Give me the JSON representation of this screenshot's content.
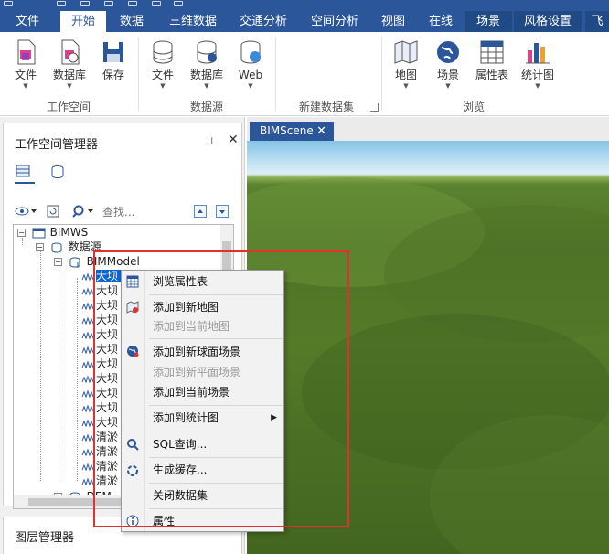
{
  "menu_tabs": [
    {
      "label": "文件"
    },
    {
      "label": "开始"
    },
    {
      "label": "数据"
    },
    {
      "label": "三维数据"
    },
    {
      "label": "交通分析"
    },
    {
      "label": "空间分析"
    },
    {
      "label": "视图"
    },
    {
      "label": "在线"
    },
    {
      "label": "场景"
    },
    {
      "label": "风格设置"
    },
    {
      "label": "飞"
    }
  ],
  "ribbon": {
    "workspace_group": {
      "label": "工作空间",
      "buttons": [
        "文件",
        "数据库",
        "保存"
      ]
    },
    "datasource_group": {
      "label": "数据源",
      "buttons": [
        "文件",
        "数据库",
        "Web"
      ]
    },
    "new_dataset_group": {
      "label": "新建数据集"
    },
    "browse_group": {
      "label": "浏览",
      "buttons": [
        "地图",
        "场景",
        "属性表",
        "统计图"
      ]
    }
  },
  "workspace_manager": {
    "title": "工作空间管理器",
    "pin_glyph": "⊥",
    "close_glyph": "✕",
    "search_placeholder": "查找...",
    "tree": {
      "workspace": "BIMWS",
      "datasources": "数据源",
      "datasource": "BIMModel",
      "selected_item": "大坝_结构_分类_Defa",
      "items": [
        "大坝",
        "大坝",
        "大坝",
        "大坝",
        "大坝",
        "大坝",
        "大坝",
        "大坝",
        "大坝",
        "大坝",
        "清淤",
        "清淤",
        "清淤",
        "清淤"
      ],
      "next_datasource": "DEM"
    }
  },
  "layer_manager": {
    "title": "图层管理器"
  },
  "scene_tab": {
    "label": "BIMScene",
    "close_glyph": "✕"
  },
  "context_menu": {
    "browse_table": "浏览属性表",
    "add_new_map": "添加到新地图",
    "add_current_map": "添加到当前地图",
    "add_new_sphere_scene": "添加到新球面场景",
    "add_new_plane_scene": "添加到新平面场景",
    "add_current_scene": "添加到当前场景",
    "add_chart": "添加到统计图",
    "sql_query": "SQL查询...",
    "gen_cache": "生成缓存...",
    "close_dataset": "关闭数据集",
    "properties": "属性"
  }
}
